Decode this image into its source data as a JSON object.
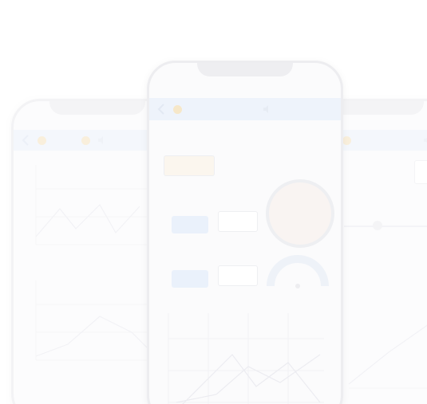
{
  "colors": {
    "appbar": "#eef3fb",
    "accent": "#f6e7c9",
    "button": "#eaf1fb"
  },
  "center": {
    "appbar_icons": [
      "back-chevron-icon",
      "status-dot-icon",
      "speaker-icon"
    ],
    "widget_label": "",
    "field_1": "",
    "field_2": "",
    "button_1": "",
    "button_2": "",
    "chart_title": ""
  }
}
